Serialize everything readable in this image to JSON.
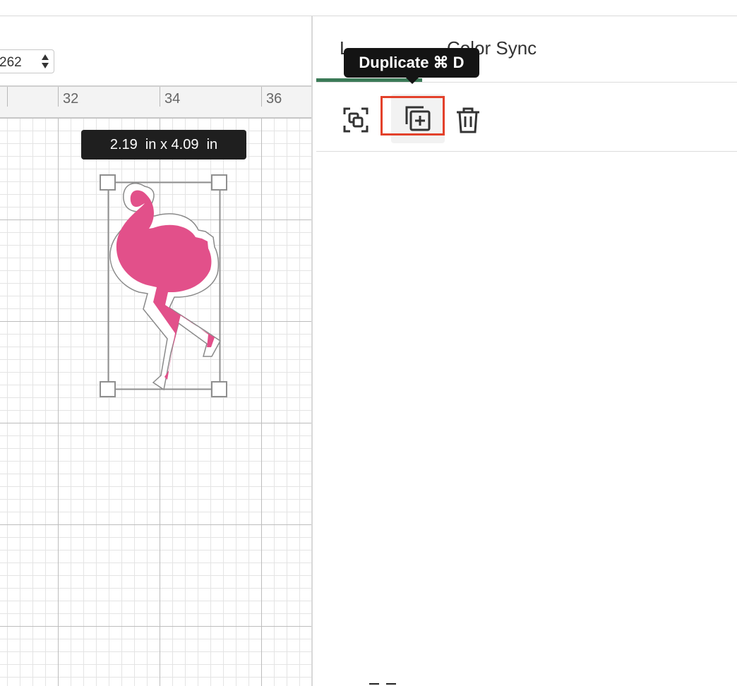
{
  "stepper": {
    "value": "262"
  },
  "ruler": {
    "ticks": [
      "32",
      "34",
      "36"
    ]
  },
  "selection": {
    "dimension_label": "2.19  in x 4.09  in",
    "colors": {
      "fill": "#e2508a",
      "handle_border": "#8f8f8f"
    }
  },
  "panel": {
    "tabs": [
      {
        "label": "L"
      },
      {
        "label": "Color Sync"
      }
    ],
    "tooltip": "Duplicate ⌘ D",
    "actions": [
      {
        "icon": "group-icon"
      },
      {
        "icon": "duplicate-icon"
      },
      {
        "icon": "trash-icon"
      }
    ],
    "colors": {
      "accent": "#3b7a57",
      "highlight": "#e3412b"
    }
  }
}
